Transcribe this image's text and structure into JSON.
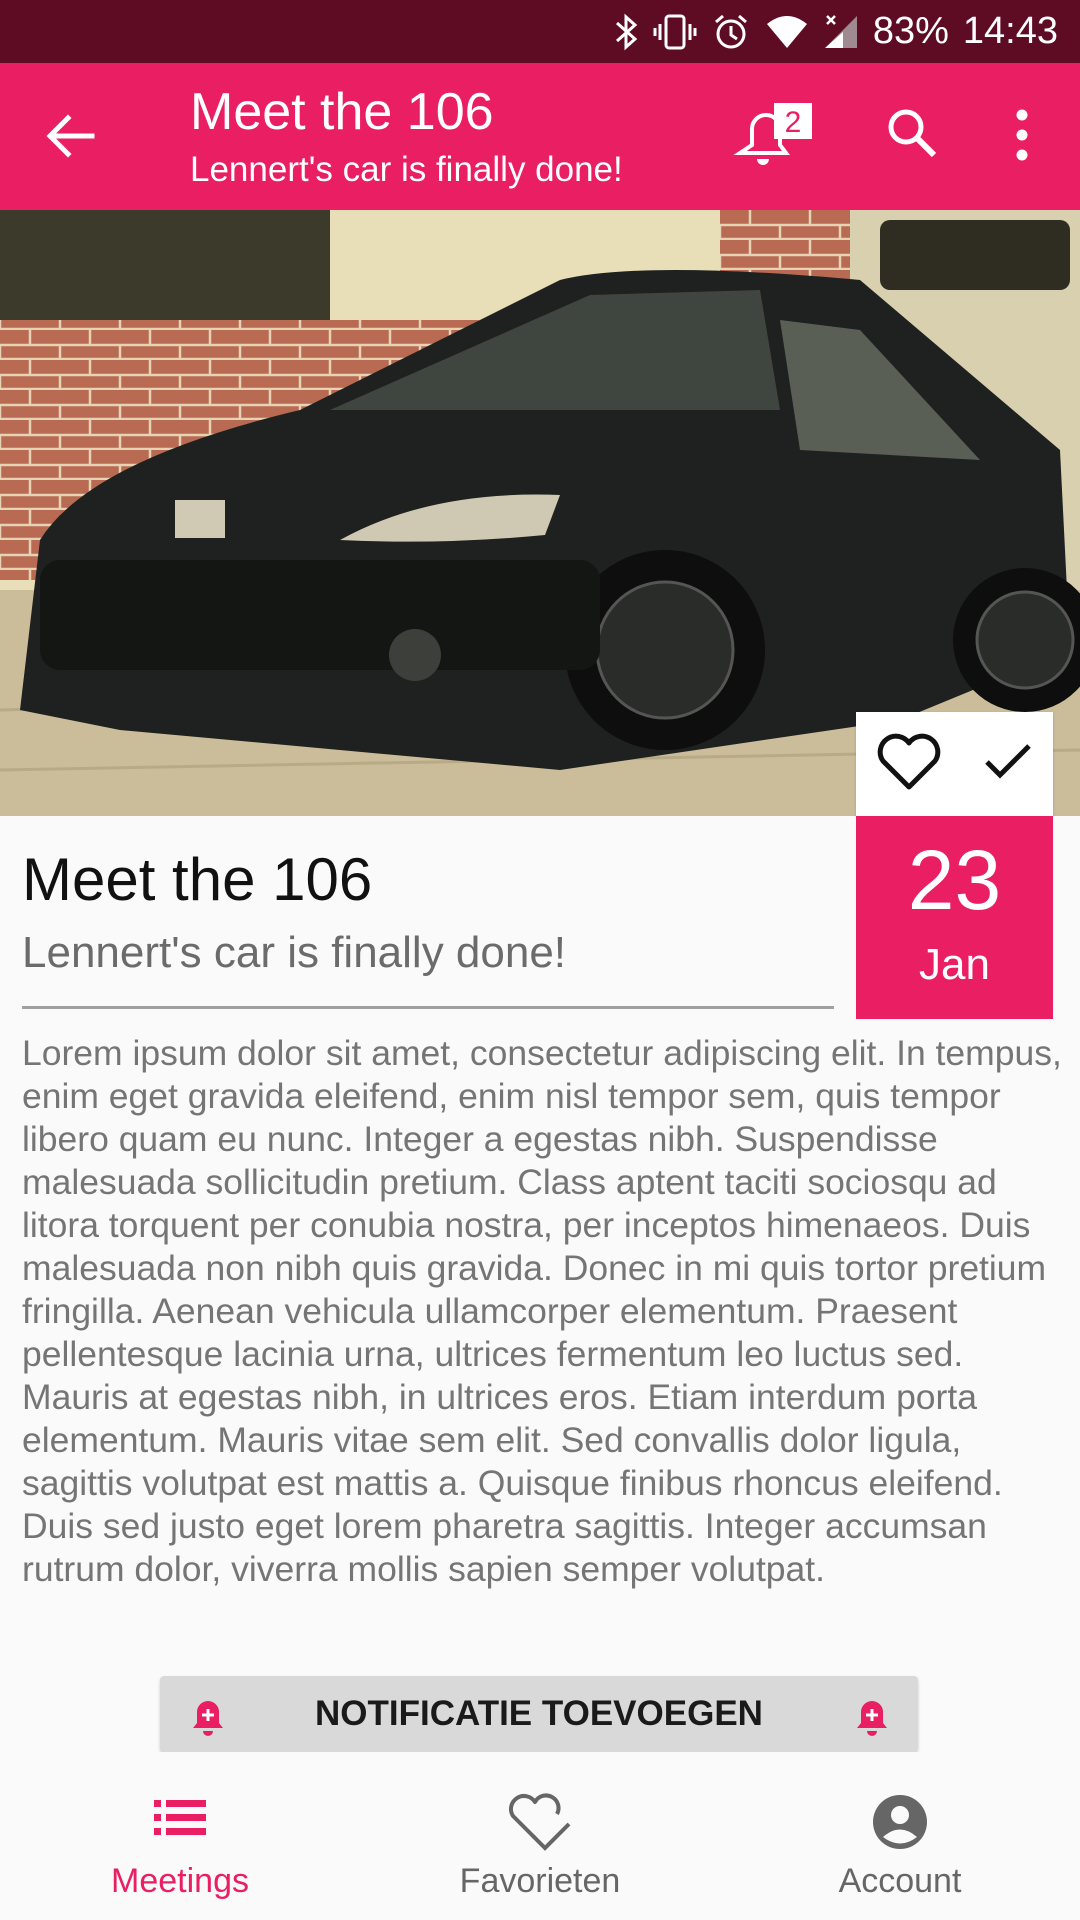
{
  "status_bar": {
    "battery": "83%",
    "time": "14:43"
  },
  "app_bar": {
    "title": "Meet the 106",
    "subtitle": "Lennert's car is finally done!",
    "notification_count": "2",
    "icons": [
      "back-arrow-icon",
      "notification-bell-icon",
      "search-icon",
      "more-vert-icon"
    ]
  },
  "event": {
    "date_day": "23",
    "date_month": "Jan",
    "title": "Meet the 106",
    "subtitle": "Lennert's car is finally done!",
    "body": "Lorem ipsum dolor sit amet, consectetur adipiscing elit. In tempus, enim eget gravida eleifend, enim nisl tempor sem, quis tempor libero quam eu nunc. Integer a egestas nibh. Suspendisse malesuada sollicitudin pretium. Class aptent taciti sociosqu ad litora torquent per conubia nostra, per inceptos himenaeos. Duis malesuada non nibh quis gravida. Donec in mi quis tortor pretium fringilla. Aenean vehicula ullamcorper elementum. Praesent pellentesque lacinia urna, ultrices fermentum leo luctus sed. Mauris at egestas nibh, in ultrices eros. Etiam interdum porta elementum. Mauris vitae sem elit. Sed convallis dolor ligula, sagittis volutpat est mattis a. Quisque finibus rhoncus eleifend. Duis sed justo eget lorem pharetra sagittis. Integer accumsan rutrum dolor, viverra mollis sapien semper volutpat."
  },
  "notification_button": {
    "label": "NOTIFICATIE TOEVOEGEN"
  },
  "bottom_nav": {
    "items": [
      {
        "label": "Meetings",
        "icon": "list-icon",
        "active": true
      },
      {
        "label": "Favorieten",
        "icon": "heart-check-icon",
        "active": false
      },
      {
        "label": "Account",
        "icon": "account-circle-icon",
        "active": false
      }
    ]
  },
  "colors": {
    "accent": "#e91e63",
    "status_bar": "#5e0b24"
  }
}
